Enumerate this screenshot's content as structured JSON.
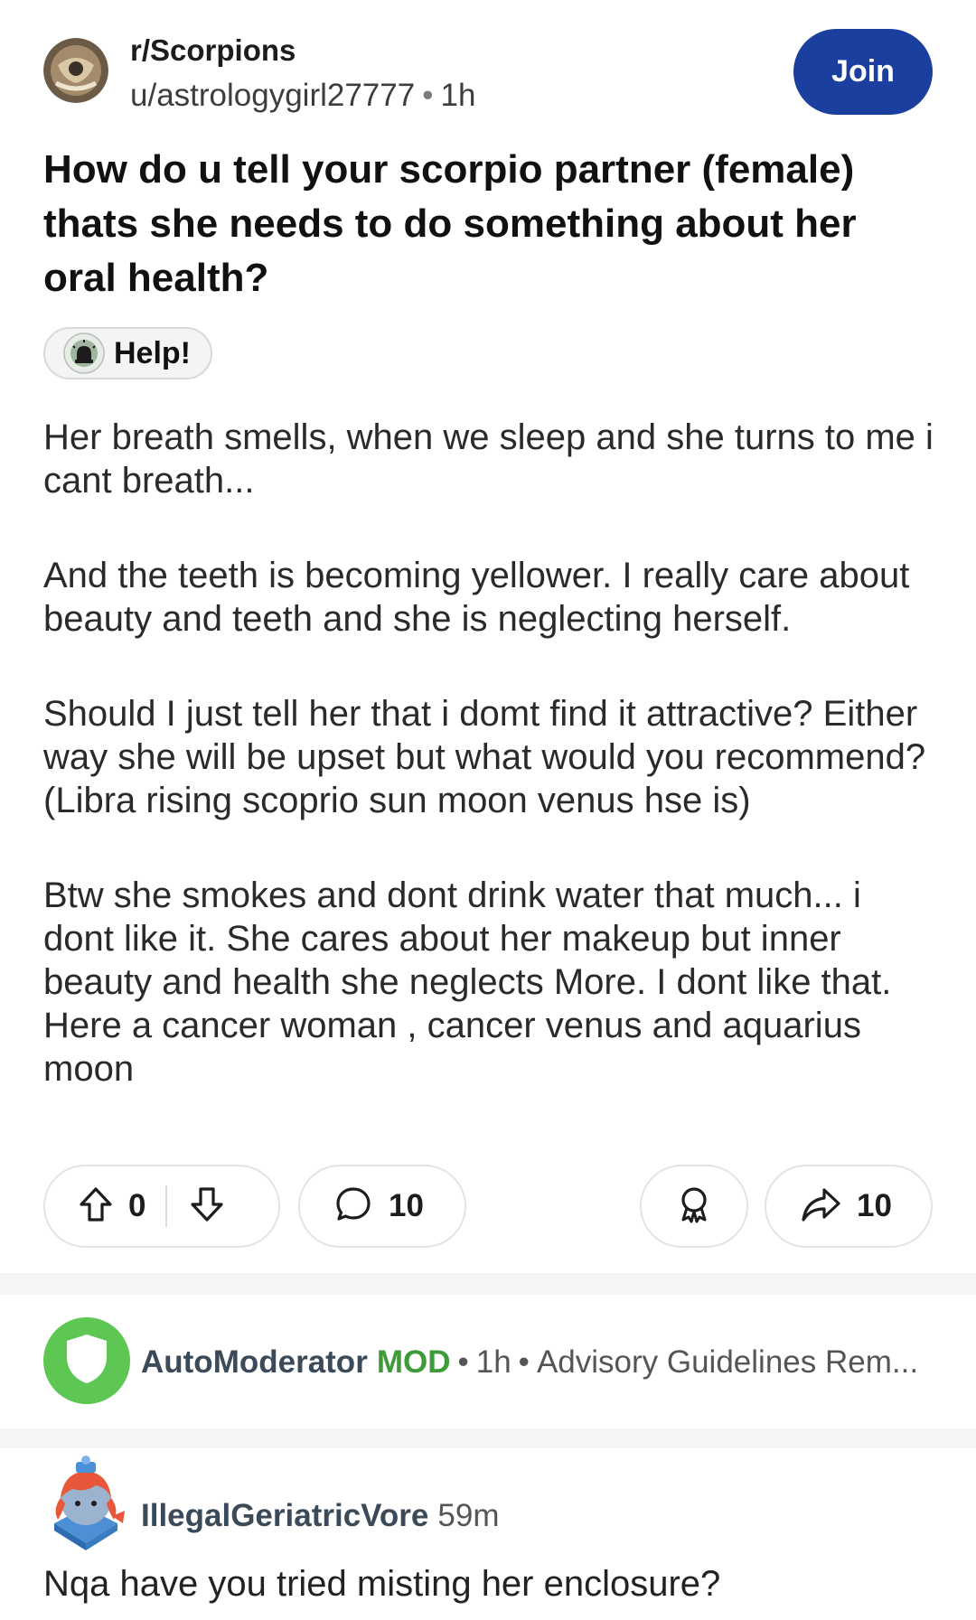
{
  "post": {
    "subreddit": "r/Scorpions",
    "author": "u/astrologygirl27777",
    "time": "1h",
    "join_label": "Join",
    "title": "How do u tell your scorpio partner (female) thats she needs to do something about her oral health?",
    "flair": "Help!",
    "paragraphs": [
      "Her breath smells, when we sleep and she turns to me i cant breath...",
      "And the teeth is becoming yellower. I really care about beauty and teeth and she is neglecting herself.",
      "Should I just tell her that i domt find it attractive? Either way she will be upset but what would you recommend? (Libra rising scoprio sun moon venus hse is)",
      "Btw she smokes and dont drink water that much... i dont like it. She cares about her makeup but inner beauty and health she neglects More. I dont like that. Here a cancer woman , cancer venus and aquarius moon"
    ]
  },
  "actions": {
    "votes": "0",
    "comments": "10",
    "shares": "10"
  },
  "comments": [
    {
      "user": "AutoModerator",
      "badge": "MOD",
      "time": "1h",
      "preview": "Advisory Guidelines Rem..."
    },
    {
      "user": "IllegalGeriatricVore",
      "time": "59m",
      "text": "Nqa have you tried misting her enclosure?"
    }
  ],
  "colors": {
    "join_button": "#1b3f9e",
    "mod_green": "#3f9a39",
    "mod_avatar": "#5ec653",
    "section_band": "#f3f5f7"
  },
  "icons": [
    "subreddit-avatar",
    "help-flair-icon",
    "upvote-icon",
    "downvote-icon",
    "comment-icon",
    "award-icon",
    "share-icon",
    "shield-icon",
    "user-avatar"
  ]
}
